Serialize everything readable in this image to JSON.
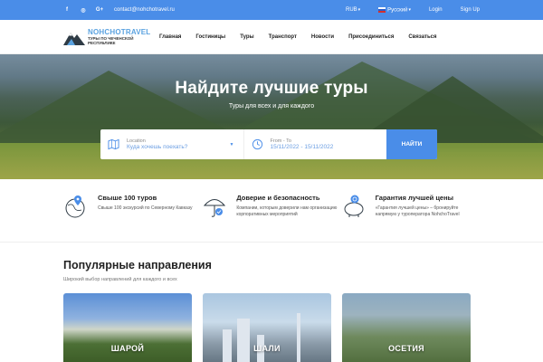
{
  "topbar": {
    "socials": [
      "f",
      "◎",
      "G+"
    ],
    "email": "contact@nohchotravel.ru",
    "currency": "RUB",
    "language": "Русский",
    "login": "Login",
    "signup": "Sign Up"
  },
  "logo": {
    "brand": "NOHCHOTRAVEL",
    "subtitle_line1": "ТУРЫ ПО ЧЕЧЕНСКОЙ",
    "subtitle_line2": "РЕСПУБЛИКЕ"
  },
  "nav": [
    "Главная",
    "Гостиницы",
    "Туры",
    "Транспорт",
    "Новости",
    "Присоединиться",
    "Связаться"
  ],
  "hero": {
    "title": "Найдите лучшие туры",
    "tagline": "Туры для всех и для каждого"
  },
  "search": {
    "location_label": "Location",
    "location_value": "Куда хочешь поехать?",
    "dates_label": "From - To",
    "dates_value": "15/11/2022 - 15/11/2022",
    "button": "НАЙТИ"
  },
  "features": [
    {
      "title": "Свыше 100 туров",
      "desc": "Свыше 100 экскурсий по Северному Кавказу"
    },
    {
      "title": "Доверие и безопасность",
      "desc": "Компании, которым доверили нам организацию корпоративных мероприятий"
    },
    {
      "title": "Гарантия лучшей цены",
      "desc": "«Гарантия лучшей цены» – бронируйте напрямую у туроператора NohchoTravel"
    }
  ],
  "destinations": {
    "title": "Популярные направления",
    "subtitle": "Широкий выбор направлений для каждого и всех",
    "cards": [
      "ШАРОЙ",
      "ШАЛИ",
      "ОСЕТИЯ"
    ]
  },
  "colors": {
    "accent": "#4a8de8",
    "brand": "#5aa2e0"
  }
}
